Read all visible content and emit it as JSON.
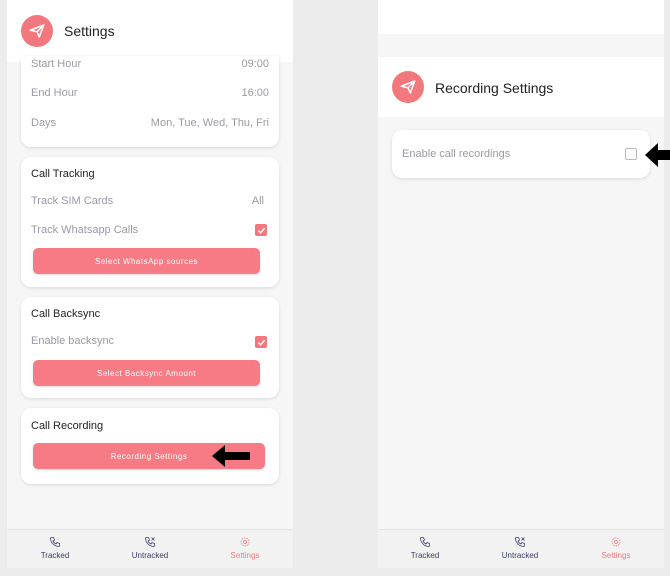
{
  "left_screen": {
    "header": {
      "title": "Settings",
      "logo_icon": "paper-plane-icon"
    },
    "schedule_card": {
      "rows": [
        {
          "label": "Start Hour",
          "value": "09:00"
        },
        {
          "label": "End Hour",
          "value": "16:00"
        },
        {
          "label": "Days",
          "value": "Mon, Tue, Wed, Thu, Fri"
        }
      ]
    },
    "call_tracking": {
      "title": "Call Tracking",
      "sim_label": "Track SIM Cards",
      "sim_value": "All",
      "whatsapp_label": "Track Whatsapp Calls",
      "whatsapp_checked": true,
      "button": "Select WhatsApp sources"
    },
    "call_backsync": {
      "title": "Call Backsync",
      "enable_label": "Enable backsync",
      "enable_checked": true,
      "button": "Select Backsync Amount"
    },
    "call_recording": {
      "title": "Call Recording",
      "button": "Recording Settings"
    }
  },
  "right_screen": {
    "header": {
      "title": "Recording Settings",
      "logo_icon": "paper-plane-icon"
    },
    "enable_recordings": {
      "label": "Enable call recordings",
      "checked": false
    }
  },
  "nav": {
    "items": [
      {
        "label": "Tracked",
        "icon": "phone-icon"
      },
      {
        "label": "Untracked",
        "icon": "phone-missed-icon"
      },
      {
        "label": "Settings",
        "icon": "gear-icon",
        "active": true
      }
    ]
  },
  "colors": {
    "accent": "#f2787e",
    "button": "#f77b84",
    "nav_text": "#3a4067"
  }
}
